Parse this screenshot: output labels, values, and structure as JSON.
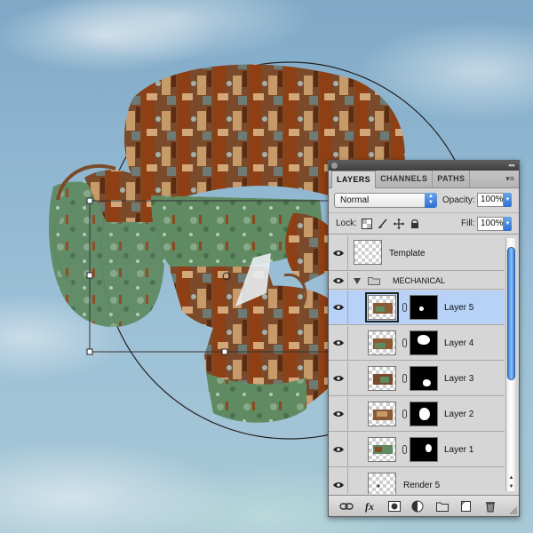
{
  "panel": {
    "tabs": [
      {
        "label": "LAYERS",
        "active": true
      },
      {
        "label": "CHANNELS",
        "active": false
      },
      {
        "label": "PATHS",
        "active": false
      }
    ],
    "blend_mode": "Normal",
    "opacity_label": "Opacity:",
    "opacity_value": "100%",
    "lock_label": "Lock:",
    "fill_label": "Fill:",
    "fill_value": "100%"
  },
  "layers": [
    {
      "name": "Template",
      "type": "layer",
      "visible": true,
      "mask": false,
      "selected": false
    },
    {
      "name": "MECHANICAL",
      "type": "group",
      "visible": true,
      "expanded": true
    },
    {
      "name": "Layer 5",
      "type": "layer",
      "visible": true,
      "mask": true,
      "selected": true
    },
    {
      "name": "Layer 4",
      "type": "layer",
      "visible": true,
      "mask": true,
      "selected": false
    },
    {
      "name": "Layer 3",
      "type": "layer",
      "visible": true,
      "mask": true,
      "selected": false
    },
    {
      "name": "Layer 2",
      "type": "layer",
      "visible": true,
      "mask": true,
      "selected": false
    },
    {
      "name": "Layer 1",
      "type": "layer",
      "visible": true,
      "mask": true,
      "selected": false
    },
    {
      "name": "Render 5",
      "type": "layer",
      "visible": true,
      "mask": false,
      "selected": false
    }
  ],
  "footer_icons": [
    "link-layers-icon",
    "fx-icon",
    "add-mask-icon",
    "adjustment-layer-icon",
    "new-group-icon",
    "new-layer-icon",
    "trash-icon"
  ],
  "colors": {
    "selection": "#b7d1f7",
    "panel_bg": "#d6d6d6",
    "accent_blue": "#2e6fd1",
    "sky": "#8fb6d0",
    "rust": "#8a4a1e",
    "patina": "#5f8a62"
  }
}
